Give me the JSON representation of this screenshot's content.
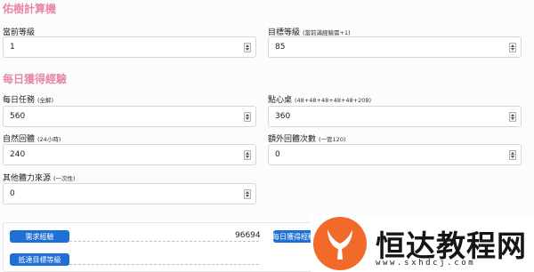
{
  "calculator": {
    "title": "佑樹計算機",
    "current_level": {
      "label": "當前等級",
      "value": "1"
    },
    "target_level": {
      "label": "目標等級",
      "note": "(當前滿經驗需+1)",
      "value": "85"
    }
  },
  "daily_exp": {
    "title": "每日獲得經驗",
    "daily_tasks": {
      "label": "每日任務",
      "note": "(全解)",
      "value": "560"
    },
    "snack_table": {
      "label": "點心桌",
      "note": "(48+48+48+48+48+208)",
      "value": "360"
    },
    "natural_recovery": {
      "label": "自然回體",
      "note": "(24小時)",
      "value": "240"
    },
    "extra_recovery": {
      "label": "額外回體次數",
      "note": "(一管120)",
      "value": "0"
    },
    "other_stamina": {
      "label": "其他體力來源",
      "note": "(一次性)",
      "value": "0"
    }
  },
  "results": {
    "required_exp_label": "需求經驗",
    "required_exp_value": "96694",
    "daily_gain_label": "每日獲得經驗",
    "reach_target_label": "抵達目標等級"
  },
  "watermark": {
    "name": "恒达教程网",
    "url": "www.sxhdcj.com",
    "color": "#f26a2a"
  },
  "colors": {
    "section_title": "#e888a6",
    "button": "#1e6fd6"
  }
}
